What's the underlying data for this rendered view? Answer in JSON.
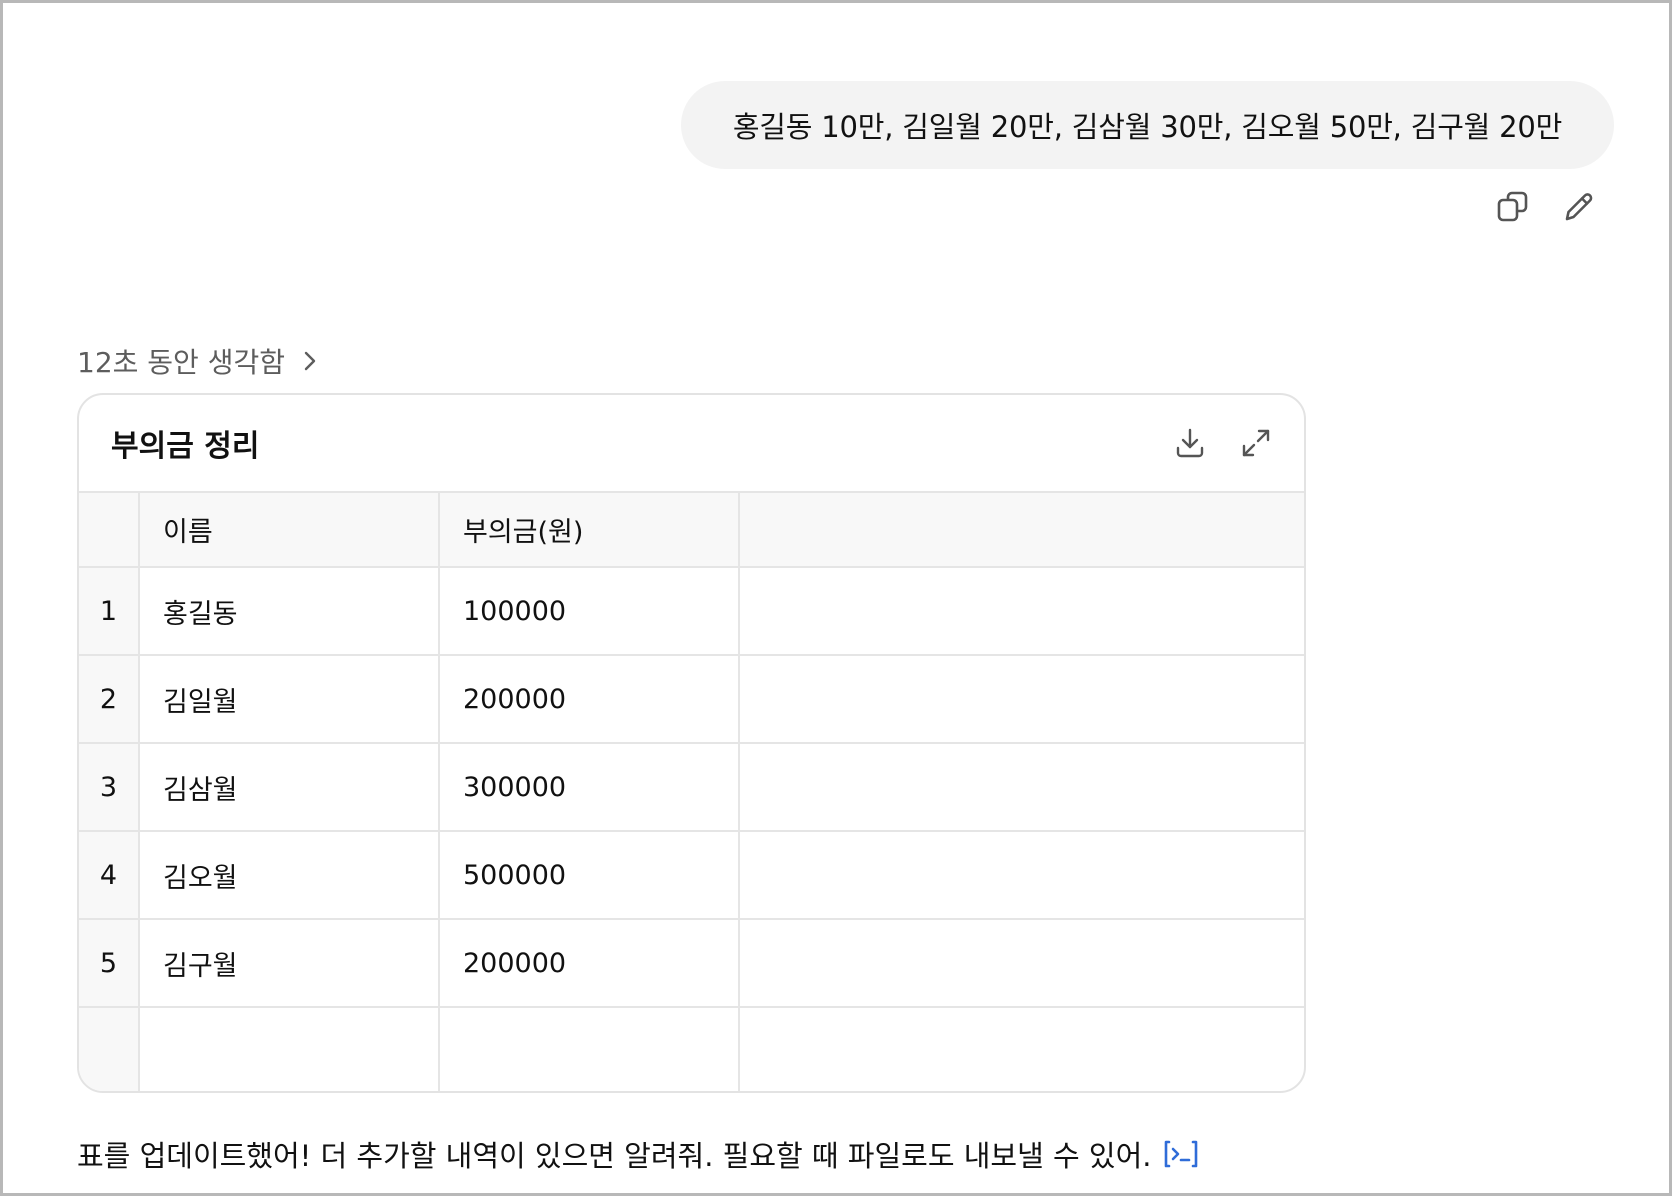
{
  "user_message": {
    "text": "홍길동 10만, 김일월 20만, 김삼월 30만, 김오월 50만, 김구월 20만"
  },
  "thinking": {
    "label": "12초 동안 생각함"
  },
  "table_card": {
    "title": "부의금 정리",
    "columns": [
      "이름",
      "부의금(원)",
      ""
    ],
    "rows": [
      {
        "index": "1",
        "name": "홍길동",
        "amount": "100000"
      },
      {
        "index": "2",
        "name": "김일월",
        "amount": "200000"
      },
      {
        "index": "3",
        "name": "김삼월",
        "amount": "300000"
      },
      {
        "index": "4",
        "name": "김오월",
        "amount": "500000"
      },
      {
        "index": "5",
        "name": "김구월",
        "amount": "200000"
      }
    ]
  },
  "reply": {
    "text": "표를 업데이트했어! 더 추가할 내역이 있으면 알려줘. 필요할 때 파일로도 내보낼 수 있어."
  },
  "icons": {
    "copy": "copy-icon",
    "edit": "pencil-icon",
    "download": "download-icon",
    "expand": "expand-icon",
    "chevron": "chevron-right-icon",
    "code": "code-icon"
  },
  "colors": {
    "code_icon": "#2f6cd8",
    "bubble": "#f3f3f3"
  }
}
